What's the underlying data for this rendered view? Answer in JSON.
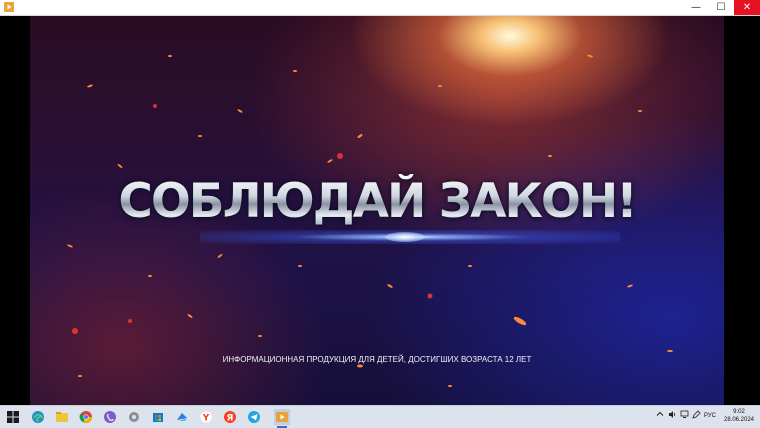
{
  "window": {
    "minimize_glyph": "—",
    "maximize_glyph": "☐",
    "close_glyph": "✕"
  },
  "video": {
    "headline": "СОБЛЮДАЙ ЗАКОН!",
    "age_notice": "ИНФОРМАЦИОННАЯ ПРОДУКЦИЯ ДЛЯ ДЕТЕЙ, ДОСТИГШИХ ВОЗРАСТА 12 ЛЕТ"
  },
  "taskbar": {
    "icons": [
      "windows-start-icon",
      "edge-icon",
      "file-explorer-icon",
      "chrome-icon",
      "viber-icon",
      "toolbox-icon",
      "store-icon",
      "app-shortcut-icon",
      "yandex-browser-icon",
      "yandex-icon",
      "telegram-icon",
      "media-player-icon"
    ],
    "tray": {
      "language": "РУС",
      "time": "9:02",
      "date": "28.06.2024"
    }
  },
  "colors": {
    "close_button": "#e81123",
    "taskbar": "#dce3ec",
    "active_indicator": "#2f6fd6"
  }
}
